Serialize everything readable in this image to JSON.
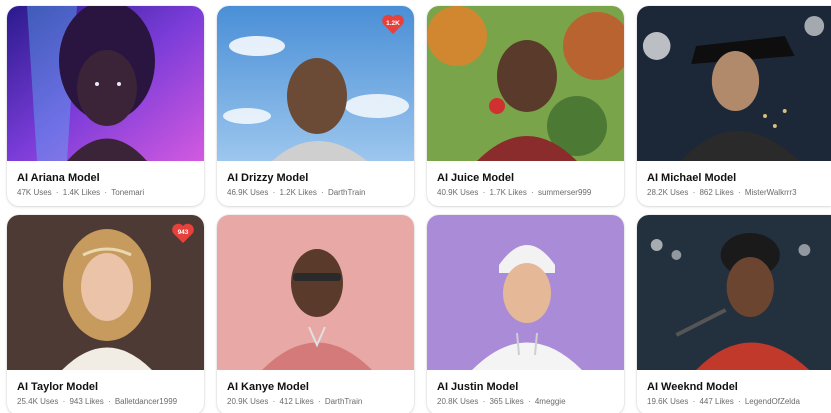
{
  "colors": {
    "heart": "#e8413c",
    "title": "#111111",
    "meta": "#6b6b6b"
  },
  "models": [
    {
      "title": "AI Ariana Model",
      "uses": "47K Uses",
      "likes": "1.4K Likes",
      "author": "Tonemari",
      "badge": ""
    },
    {
      "title": "AI Drizzy Model",
      "uses": "46.9K Uses",
      "likes": "1.2K Likes",
      "author": "DarthTrain",
      "badge": "1.2K"
    },
    {
      "title": "AI Juice Model",
      "uses": "40.9K Uses",
      "likes": "1.7K Likes",
      "author": "summerser999",
      "badge": ""
    },
    {
      "title": "AI Michael Model",
      "uses": "28.2K Uses",
      "likes": "862 Likes",
      "author": "MisterWalkrrr3",
      "badge": ""
    },
    {
      "title": "AI Taylor Model",
      "uses": "25.4K Uses",
      "likes": "943 Likes",
      "author": "Balletdancer1999",
      "badge": "943"
    },
    {
      "title": "AI Kanye Model",
      "uses": "20.9K Uses",
      "likes": "412 Likes",
      "author": "DarthTrain",
      "badge": ""
    },
    {
      "title": "AI Justin Model",
      "uses": "20.8K Uses",
      "likes": "365 Likes",
      "author": "4meggie",
      "badge": ""
    },
    {
      "title": "AI Weeknd Model",
      "uses": "19.6K Uses",
      "likes": "447 Likes",
      "author": "LegendOfZelda",
      "badge": ""
    }
  ]
}
